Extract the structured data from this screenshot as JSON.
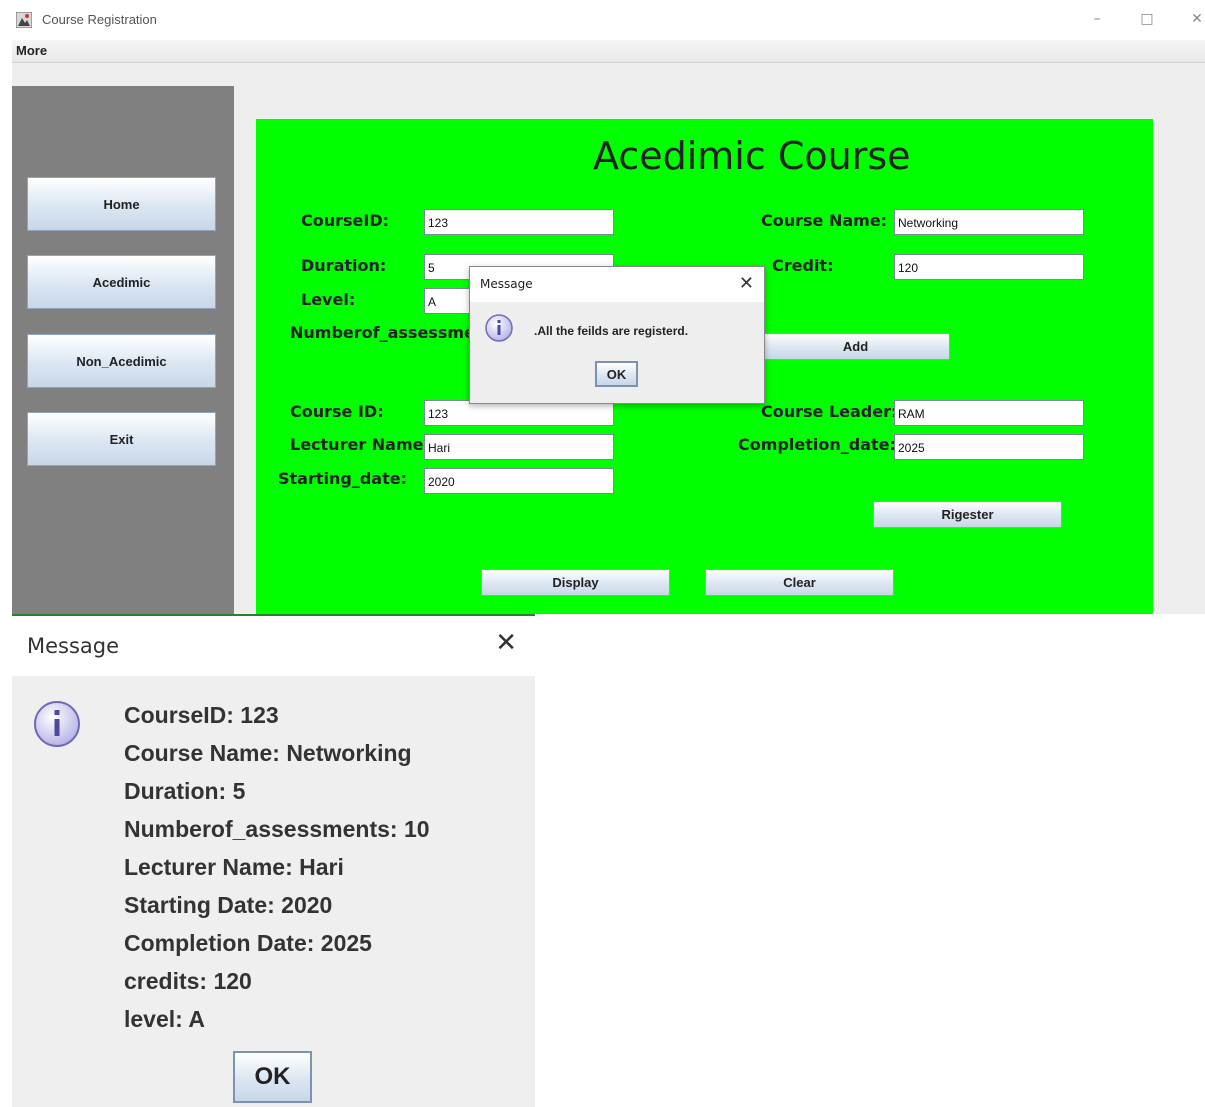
{
  "window": {
    "title": "Course Registration",
    "minimize": "–",
    "maximize": "□",
    "close": "✕"
  },
  "menu": {
    "more": "More"
  },
  "sidebar": {
    "items": [
      {
        "label": "Home"
      },
      {
        "label": "Acedimic"
      },
      {
        "label": "Non_Acedimic"
      },
      {
        "label": "Exit"
      }
    ]
  },
  "form": {
    "heading": "Acedimic Course",
    "course_id_label": "CourseID:",
    "course_id_value": "123",
    "course_name_label": "Course Name:",
    "course_name_value": "Networking",
    "duration_label": "Duration:",
    "duration_value": "5",
    "credit_label": "Credit:",
    "credit_value": "120",
    "level_label": "Level:",
    "level_value": "A",
    "assessments_label": "Numberof_assessments:",
    "add_button": "Add",
    "course_id2_label": "Course ID:",
    "course_id2_value": "123",
    "course_leader_label": "Course Leader:",
    "course_leader_value": "RAM",
    "lecturer_label": "Lecturer Name:",
    "lecturer_value": "Hari",
    "completion_label": "Completion_date:",
    "completion_value": "2025",
    "starting_label": "Starting_date:",
    "starting_value": "2020",
    "register_button": "Rigester",
    "display_button": "Display",
    "clear_button": "Clear"
  },
  "dialog_small": {
    "title": "Message",
    "message": ".All the feilds are registerd.",
    "ok": "OK",
    "close": "✕",
    "icon": "info-icon"
  },
  "dialog_large": {
    "title": "Message",
    "close": "✕",
    "ok": "OK",
    "icon": "info-icon",
    "lines": [
      "CourseID: 123",
      "Course Name: Networking",
      "Duration: 5",
      "Numberof_assessments: 10",
      "Lecturer Name: Hari",
      "Starting Date: 2020",
      "Completion Date: 2025",
      "credits: 120",
      "level: A"
    ]
  },
  "colors": {
    "panel": "#00ff00",
    "sidebar": "#808080",
    "frame": "#eeeeee"
  }
}
